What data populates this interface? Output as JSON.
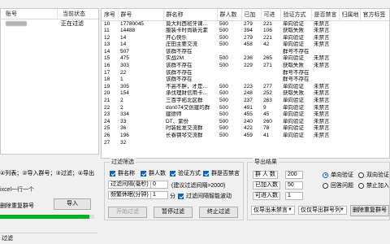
{
  "left_table": {
    "headers": [
      "账号",
      "当前状态"
    ],
    "rows": [
      {
        "account": "",
        "status": "正在过滤"
      },
      {
        "account": "",
        "status": ""
      }
    ]
  },
  "main_table": {
    "headers": [
      "序号",
      "群号",
      "群名称",
      "群人数",
      "已加",
      "可进",
      "验证方式",
      "是否禁言",
      "归属地",
      "官方标签"
    ],
    "rows": [
      {
        "no": "10",
        "gid": "17780045",
        "name": "竟大利西班牙课…",
        "members": "500",
        "added": "279",
        "enter": "221",
        "verify": "单向验证",
        "mute": "未禁言"
      },
      {
        "no": "11",
        "gid": "14488",
        "name": "服装卡时尚新元素",
        "members": "500",
        "added": "394",
        "enter": "106",
        "verify": "获取失败",
        "mute": "未禁言"
      },
      {
        "no": "12",
        "gid": "14",
        "name": "开心快乐",
        "members": "500",
        "added": "279",
        "enter": "221",
        "verify": "单向验证",
        "mute": "未禁言"
      },
      {
        "no": "13",
        "gid": "14",
        "name": "庄田主要交流",
        "members": "500",
        "added": "458",
        "enter": "42",
        "verify": "单向验证",
        "mute": "未禁言"
      },
      {
        "no": "14",
        "gid": "507",
        "name": "该群不存在",
        "members": "",
        "added": "",
        "enter": "",
        "verify": "群号不存在",
        "mute": ""
      },
      {
        "no": "15",
        "gid": "475",
        "name": "实战2M",
        "members": "500",
        "added": "236",
        "enter": "265",
        "verify": "单向验证",
        "mute": "未禁言"
      },
      {
        "no": "16",
        "gid": "303",
        "name": "该群不存在",
        "members": "500",
        "added": "229",
        "enter": "271",
        "verify": "获取失败",
        "mute": "未禁言"
      },
      {
        "no": "17",
        "gid": "22",
        "name": "该群不存在",
        "members": "",
        "added": "",
        "enter": "",
        "verify": "群号不存在",
        "mute": ""
      },
      {
        "no": "18",
        "gid": "1",
        "name": "该群不存在",
        "members": "",
        "added": "",
        "enter": "",
        "verify": "群号不存在",
        "mute": ""
      },
      {
        "no": "19",
        "gid": "305",
        "name": "不高不胖，才是…",
        "members": "500",
        "added": "223",
        "enter": "277",
        "verify": "单向验证",
        "mute": "未禁言"
      },
      {
        "no": "20",
        "gid": "154",
        "name": "承伐理财信用卡…",
        "members": "500",
        "added": "248",
        "enter": "252",
        "verify": "获取失败",
        "mute": "未禁言"
      },
      {
        "no": "21",
        "gid": "2",
        "name": "三百字拓北区群",
        "members": "500",
        "added": "237",
        "enter": "263",
        "verify": "单向验证",
        "mute": "未禁言"
      },
      {
        "no": "22",
        "gid": "2",
        "name": "don074交创建的群",
        "members": "500",
        "added": "491",
        "enter": "9",
        "verify": "单向验证",
        "mute": "未禁言"
      },
      {
        "no": "23",
        "gid": "334",
        "name": "建德师",
        "members": "500",
        "added": "455",
        "enter": "45",
        "verify": "单向验证",
        "mute": "未禁言"
      },
      {
        "no": "24",
        "gid": "33",
        "name": "DT、紫份",
        "members": "500",
        "added": "240",
        "enter": "260",
        "verify": "单向验证",
        "mute": "未禁言"
      },
      {
        "no": "25",
        "gid": "36",
        "name": "时装批发交流群",
        "members": "500",
        "added": "422",
        "enter": "78",
        "verify": "单向验证",
        "mute": "未禁言"
      },
      {
        "no": "26",
        "gid": "196",
        "name": "长春钢琴交流群",
        "members": "500",
        "added": "459",
        "enter": "41",
        "verify": "单向验证",
        "mute": "未禁言"
      },
      {
        "no": "27",
        "gid": "32",
        "name": "",
        "members": "",
        "added": "",
        "enter": "",
        "verify": "",
        "mute": ""
      }
    ]
  },
  "import_panel": {
    "options_text": "④列表；②导入群号；③过滤；④导出",
    "hint_text": "ixcel一行一个",
    "dup_label": "删除重复群号",
    "import_button": "导入",
    "progress_value": 0.95
  },
  "filter": {
    "title": "过滤筛选",
    "checks": [
      {
        "label": "群名称",
        "checked": true
      },
      {
        "label": "群人数",
        "checked": true
      },
      {
        "label": "验证方式",
        "checked": true
      },
      {
        "label": "群是否禁言",
        "checked": true
      }
    ],
    "count_label": "过滤间隔(毫秒)",
    "count_value": "0",
    "count_note": "(建议过滤间隔>2000)",
    "limit_label": "频繁休眠(分钟)",
    "limit_value": "1",
    "limit_note": "分",
    "auto_label": "过滤间隔智能波动",
    "auto_checked": true,
    "start_button": "开始过滤",
    "pause_button": "暂停过滤",
    "stop_button": "终止过滤"
  },
  "export": {
    "title": "导出结果",
    "group_label": "群 人 数",
    "group_value": "200",
    "added_label": "已加入数",
    "added_value": "50",
    "enter_label": "可进入数",
    "enter_value": "1",
    "radios": [
      {
        "label": "单向验证",
        "checked": true
      },
      {
        "label": "双向验证",
        "checked": false
      },
      {
        "label": "回答问题",
        "checked": false
      },
      {
        "label": "禁止加入",
        "checked": false
      }
    ],
    "select1": "仅导出未禁言",
    "select2": "仅仅导出群号列",
    "clear_button": "删除重复群号"
  },
  "status_bar": {
    "text": "过滤"
  }
}
